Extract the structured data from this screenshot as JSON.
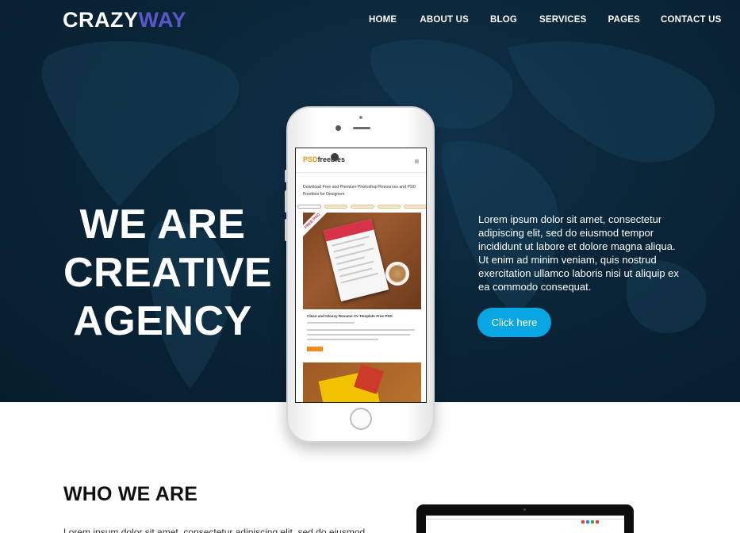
{
  "brand": {
    "name_white": "CRAZY",
    "name_accent": "WAY",
    "accent_color": "#5b57c9"
  },
  "nav": {
    "items": [
      {
        "label": "HOME"
      },
      {
        "label": "ABOUT US"
      },
      {
        "label": "BLOG"
      },
      {
        "label": "SERVICES"
      },
      {
        "label": "PAGES"
      },
      {
        "label": "CONTACT US"
      }
    ]
  },
  "hero": {
    "headline": {
      "line1": "WE ARE",
      "line2": "CREATIVE",
      "line3": "AGENCY"
    },
    "paragraph": "Lorem ipsum dolor sit amet, consectetur adipiscing elit, sed do eiusmod tempor incididunt ut labore et dolore magna aliqua. Ut enim ad minim veniam, quis nostrud exercitation ullamco laboris nisi ut aliquip ex ea commodo consequat.",
    "cta_label": "Click here",
    "cta_color": "#08a6e2",
    "background_color": "#0a2639"
  },
  "phone_screen": {
    "logo_accent": "PSD",
    "logo_rest": "freebies",
    "title": "Download Free and Premium Photoshop Resources and PSD Freebies for Designers",
    "ribbon": "FREE PSD",
    "caption": "Clean and Glossy Resume Cv Template Free PSD"
  },
  "about": {
    "title": "WHO WE ARE",
    "intro": "Lorem ipsum dolor sit amet, consectetur adipiscing elit, sed do eiusmod"
  }
}
